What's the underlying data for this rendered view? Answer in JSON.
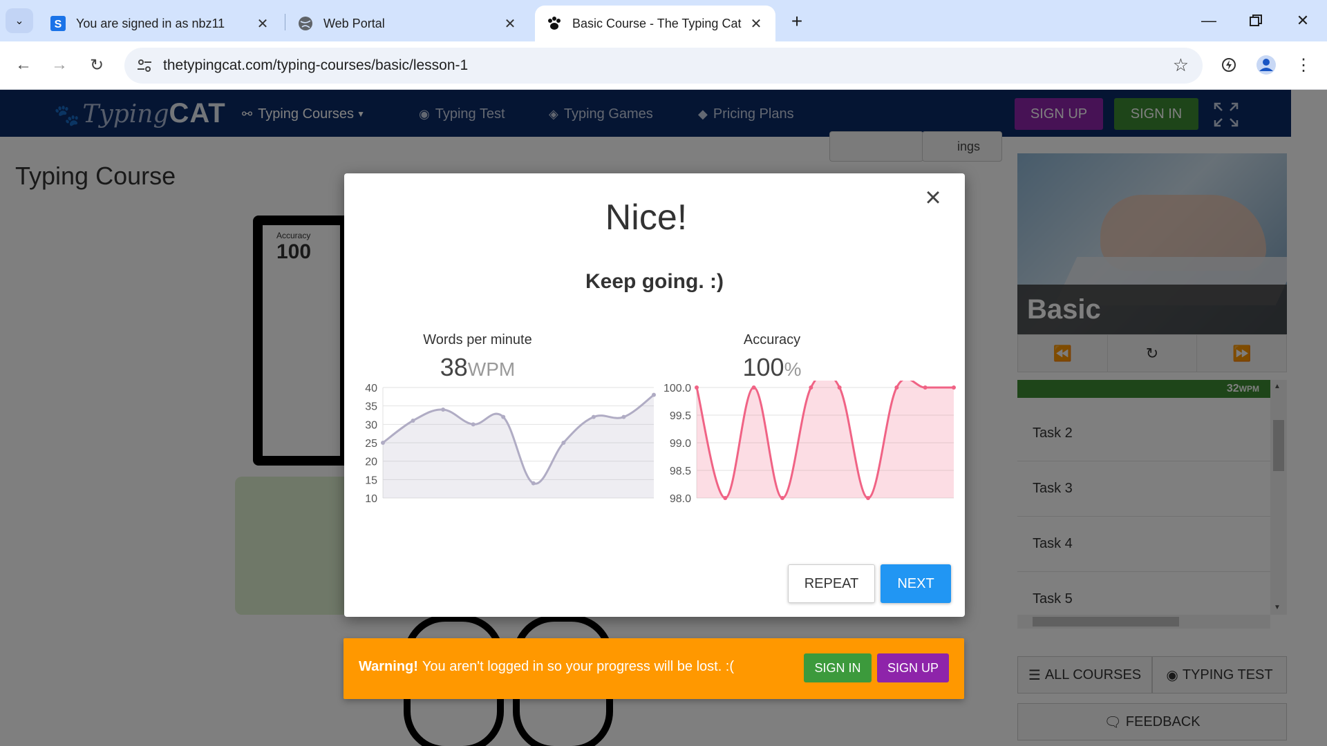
{
  "browser": {
    "tabs": [
      {
        "title": "You are signed in as nbz11",
        "favicon": "s-logo-icon"
      },
      {
        "title": "Web Portal",
        "favicon": "globe-icon"
      },
      {
        "title": "Basic Course - The Typing Cat",
        "favicon": "paw-icon",
        "active": true
      }
    ],
    "url": "thetypingcat.com/typing-courses/basic/lesson-1"
  },
  "site": {
    "logo_typing": "Typing",
    "logo_cat": "CAT",
    "nav": [
      "Typing Courses",
      "Typing Test",
      "Typing Games",
      "Pricing Plans"
    ],
    "signup": "SIGN UP",
    "signin": "SIGN IN",
    "page_title": "Typing Course",
    "settings_partial": "ings",
    "accuracy_mini_label": "Accuracy",
    "accuracy_mini_value": "100",
    "course_name": "Basic",
    "progress_wpm": "32",
    "progress_unit": "WPM",
    "tasks": [
      "Task 2",
      "Task 3",
      "Task 4",
      "Task 5"
    ],
    "all_courses": "ALL COURSES",
    "typing_test": "TYPING TEST",
    "feedback": "FEEDBACK"
  },
  "modal": {
    "headline": "Nice!",
    "subline": "Keep going. :)",
    "wpm_label": "Words per minute",
    "wpm_value": "38",
    "wpm_unit": "WPM",
    "acc_label": "Accuracy",
    "acc_value": "100",
    "acc_unit": "%",
    "repeat": "REPEAT",
    "next": "NEXT"
  },
  "warning": {
    "strong": "Warning!",
    "text": "You aren't logged in so your progress will be lost. :(",
    "signin": "SIGN IN",
    "signup": "SIGN UP"
  },
  "colors": {
    "nav_bg": "#0b2a66",
    "signup_purple": "#8e24aa",
    "signin_green": "#3c8a32",
    "next_blue": "#2196f3",
    "warning_orange": "#ff9800",
    "wpm_line": "#b0acc4",
    "acc_line": "#f06385"
  },
  "chart_data": [
    {
      "type": "line",
      "title": "Words per minute",
      "x": [
        1,
        2,
        3,
        4,
        5,
        6,
        7,
        8,
        9,
        10
      ],
      "values": [
        25,
        31,
        34,
        30,
        32,
        14,
        25,
        32,
        32,
        38
      ],
      "ylim": [
        10,
        40
      ],
      "yticks": [
        10,
        15,
        20,
        25,
        30,
        35,
        40
      ],
      "grid": true
    },
    {
      "type": "area",
      "title": "Accuracy",
      "x": [
        1,
        2,
        3,
        4,
        5,
        6,
        7,
        8,
        9,
        10
      ],
      "values": [
        100,
        98,
        100,
        98,
        100,
        100,
        98,
        100,
        100,
        100
      ],
      "ylim": [
        98,
        100
      ],
      "yticks": [
        "98.0",
        "98.5",
        "99.0",
        "99.5",
        "100.0"
      ],
      "grid": true
    }
  ]
}
